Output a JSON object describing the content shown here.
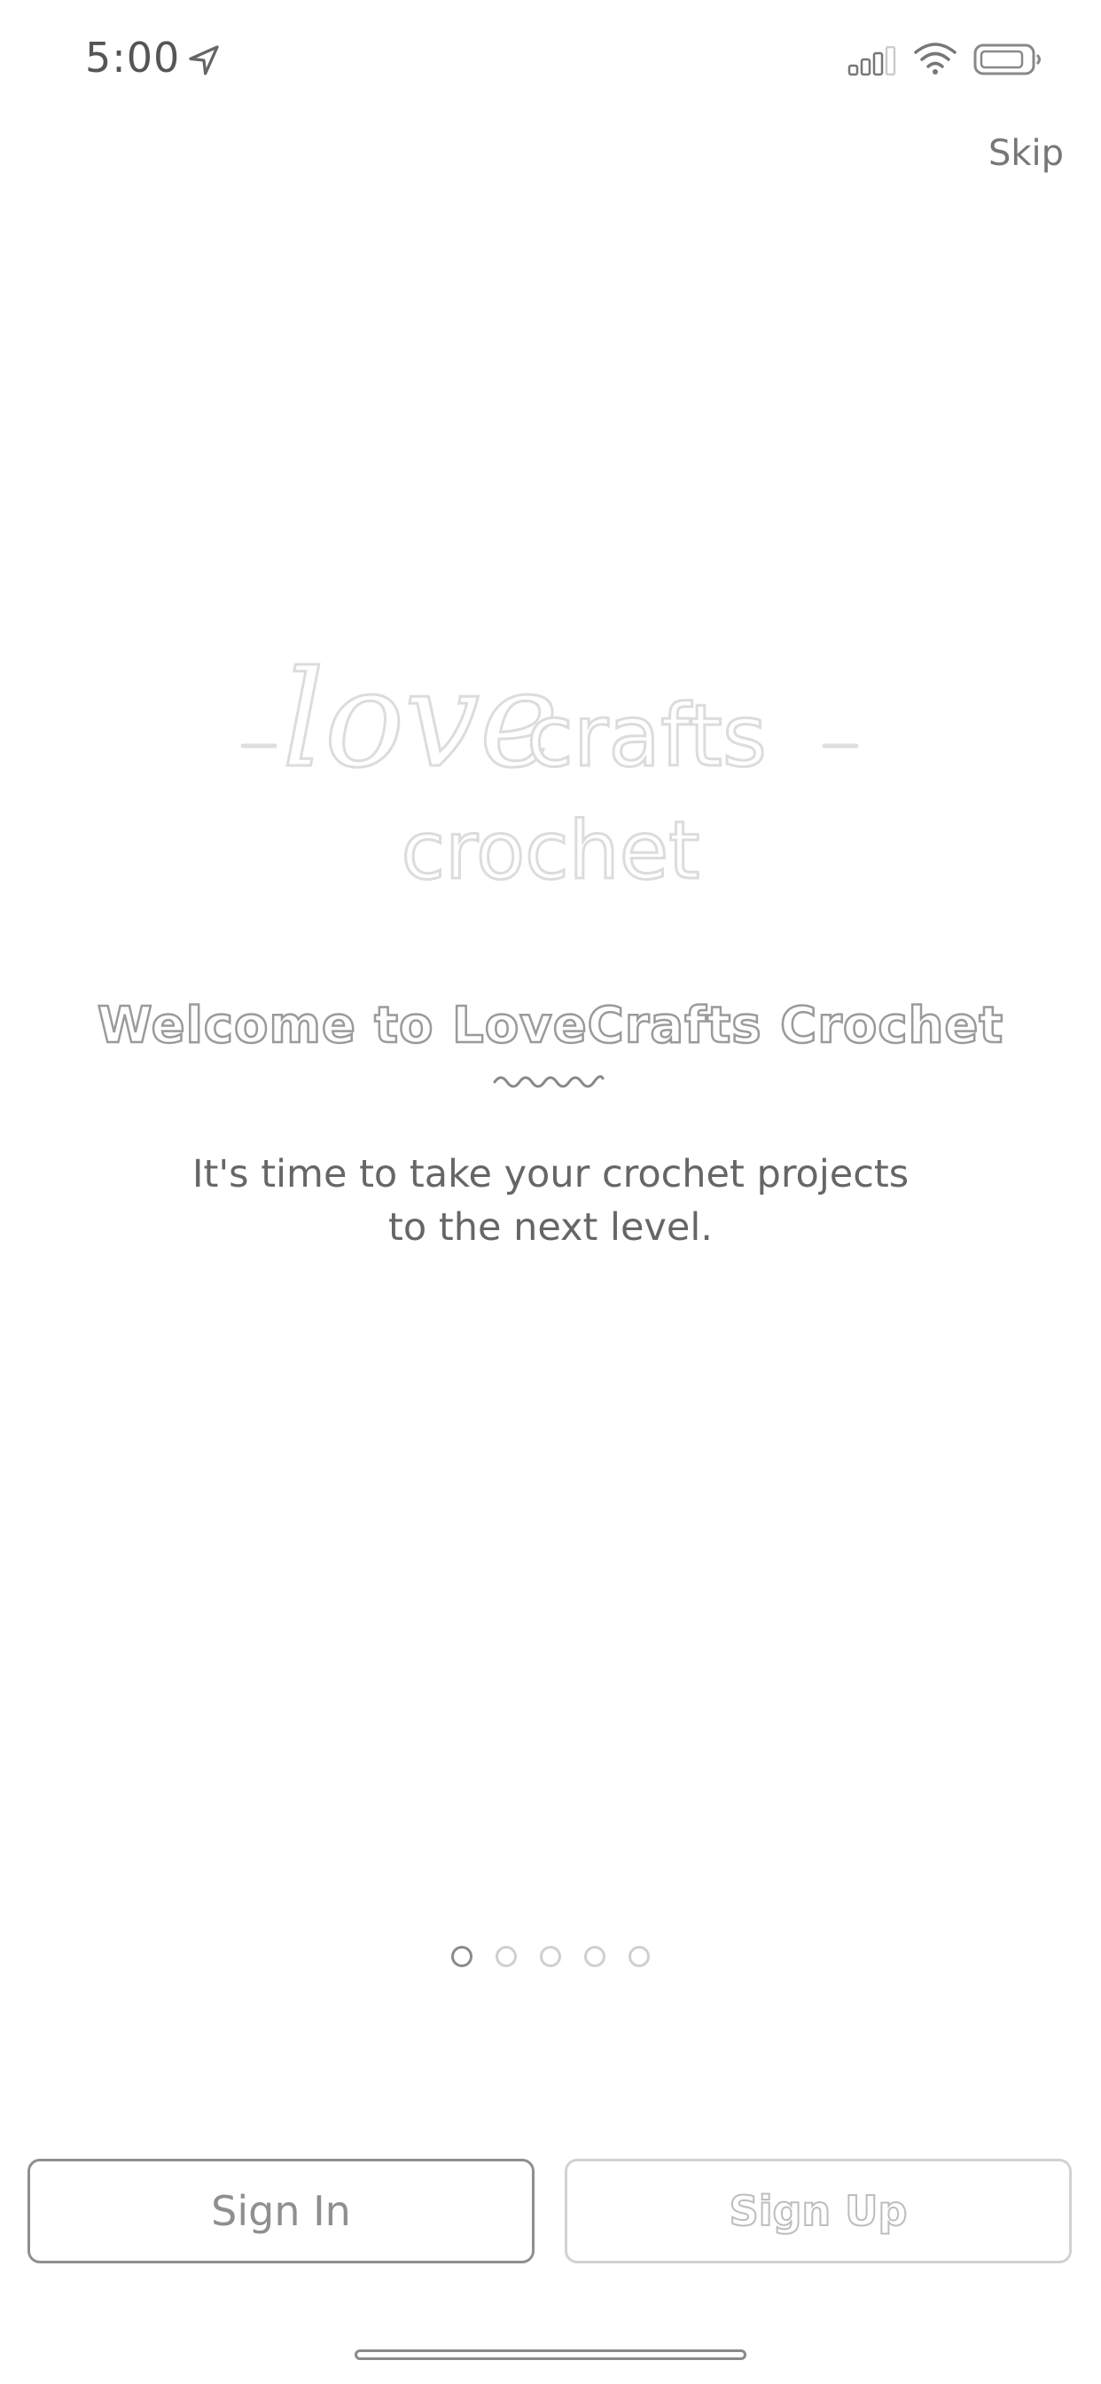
{
  "status_bar": {
    "time": "5:00",
    "icons": [
      "location-arrow-icon",
      "cellular-signal-icon",
      "wifi-icon",
      "battery-icon"
    ]
  },
  "header": {
    "skip_label": "Skip"
  },
  "logo": {
    "script_word": "love",
    "word_crafts": "crafts",
    "word_crochet": "crochet"
  },
  "welcome": {
    "title": "Welcome to LoveCrafts Crochet",
    "subtitle_line1": "It's time to take your crochet projects",
    "subtitle_line2": "to the next level."
  },
  "pager": {
    "total": 5,
    "active_index": 0
  },
  "actions": {
    "sign_in_label": "Sign In",
    "sign_up_label": "Sign Up"
  },
  "colors": {
    "outline_dark": "#8f8f8f",
    "outline_light": "#d2d2d2",
    "text": "#666666"
  }
}
